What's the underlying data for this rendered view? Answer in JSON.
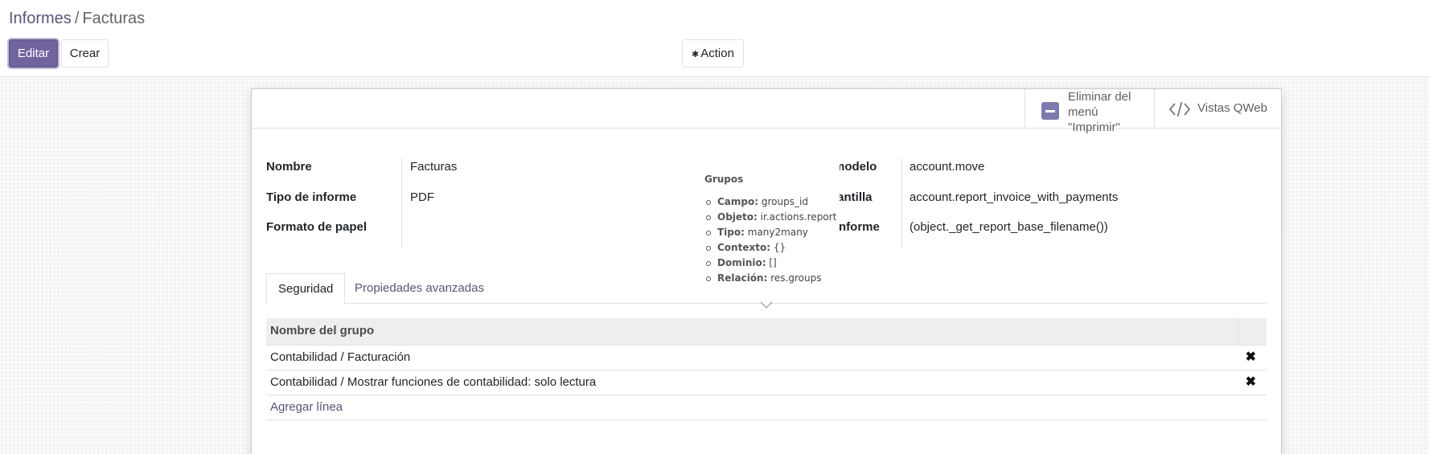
{
  "breadcrumb": {
    "parent": "Informes",
    "separator": "/",
    "current": "Facturas"
  },
  "toolbar": {
    "edit_label": "Editar",
    "create_label": "Crear",
    "action_label": "Action",
    "action_icon": "gear-icon"
  },
  "smart_buttons": {
    "unpublish_label": "Eliminar del menú \"Imprimir\"",
    "unpublish_icon": "toggle-off-icon",
    "qweb_label": "Vistas QWeb",
    "qweb_icon": "code-icon"
  },
  "fields_left": [
    {
      "label": "Nombre",
      "value": "Facturas"
    },
    {
      "label": "Tipo de informe",
      "value": "PDF"
    },
    {
      "label": "Formato de papel",
      "value": ""
    }
  ],
  "fields_right": [
    {
      "label": "modelo",
      "value": "account.move"
    },
    {
      "label": "lantilla",
      "value": "account.report_invoice_with_payments"
    },
    {
      "label": "nforme",
      "value": "(object._get_report_base_filename())"
    }
  ],
  "tabs": [
    {
      "label": "Seguridad",
      "active": true
    },
    {
      "label": "Propiedades avanzadas",
      "active": false
    }
  ],
  "groups_table": {
    "header": "Nombre del grupo",
    "rows": [
      "Contabilidad / Facturación",
      "Contabilidad / Mostrar funciones de contabilidad: solo lectura"
    ],
    "delete_glyph": "✖",
    "add_line": "Agregar línea"
  },
  "tooltip": {
    "title": "Grupos",
    "items": [
      {
        "key": "Campo:",
        "value": "groups_id"
      },
      {
        "key": "Objeto:",
        "value": "ir.actions.report"
      },
      {
        "key": "Tipo:",
        "value": "many2many"
      },
      {
        "key": "Contexto:",
        "value": "{}"
      },
      {
        "key": "Dominio:",
        "value": "[]"
      },
      {
        "key": "Relación:",
        "value": "res.groups"
      }
    ]
  },
  "colors": {
    "primary": "#71639e",
    "link": "#5f527b",
    "text": "#212529"
  }
}
